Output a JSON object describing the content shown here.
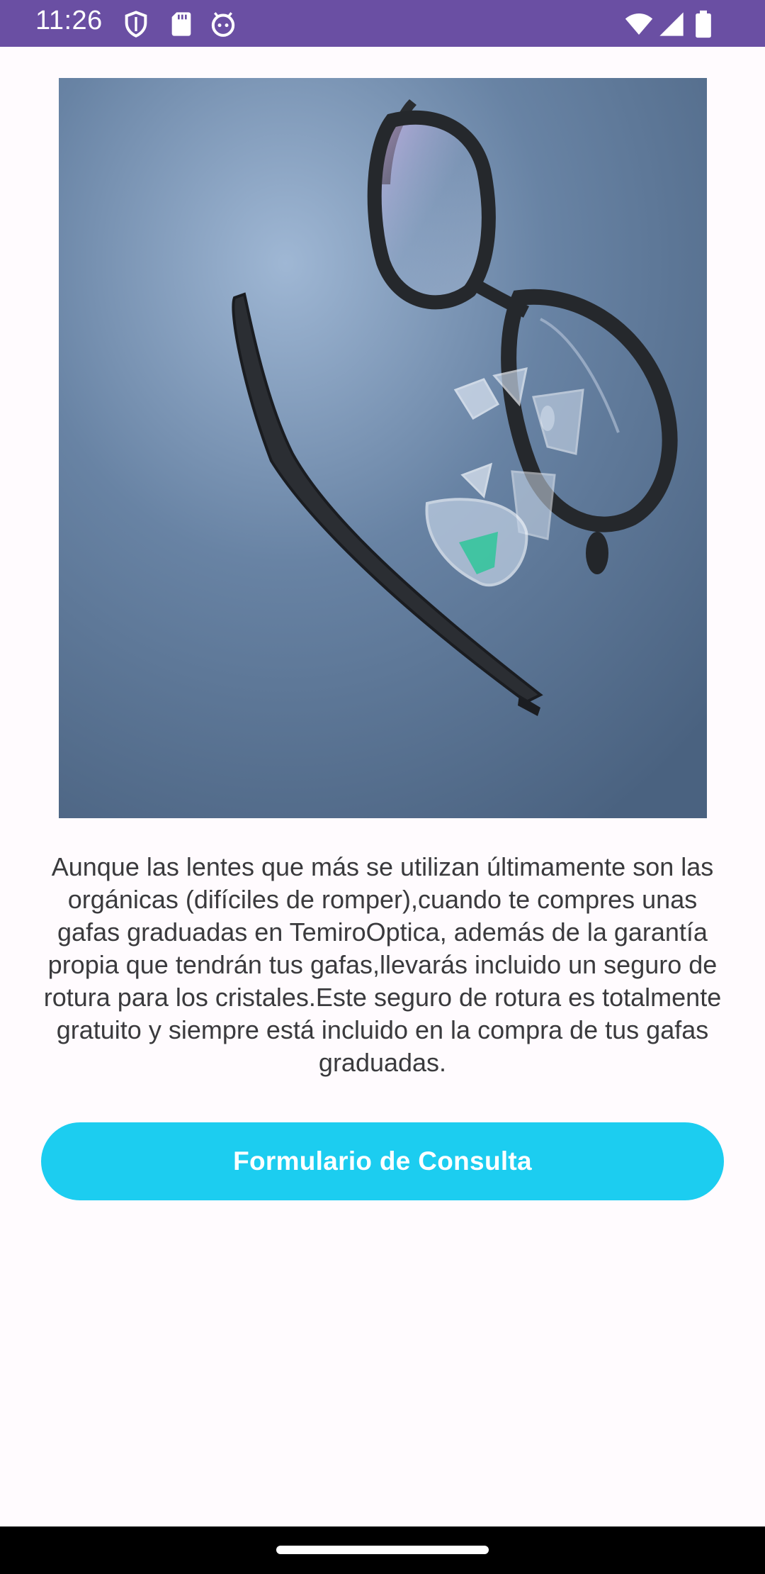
{
  "status_bar": {
    "time": "11:26",
    "left_icons": [
      "shield-icon",
      "sd-card-icon",
      "android-debug-icon"
    ],
    "right_icons": [
      "wifi-icon",
      "cell-signal-icon",
      "battery-icon"
    ],
    "background_color": "#6a4fa3"
  },
  "main": {
    "image_icon": "broken-glasses-photo",
    "description": "Aunque las lentes que más se utilizan últimamente son las orgánicas (difíciles de romper),cuando te compres unas gafas graduadas en TemiroOptica, además de la garantía propia que tendrán tus gafas,llevarás incluido un seguro de rotura para los cristales.Este seguro de rotura es totalmente gratuito y siempre está incluido en la compra de tus gafas graduadas.",
    "button_label": "Formulario de Consulta",
    "button_color": "#1ccdf0"
  }
}
